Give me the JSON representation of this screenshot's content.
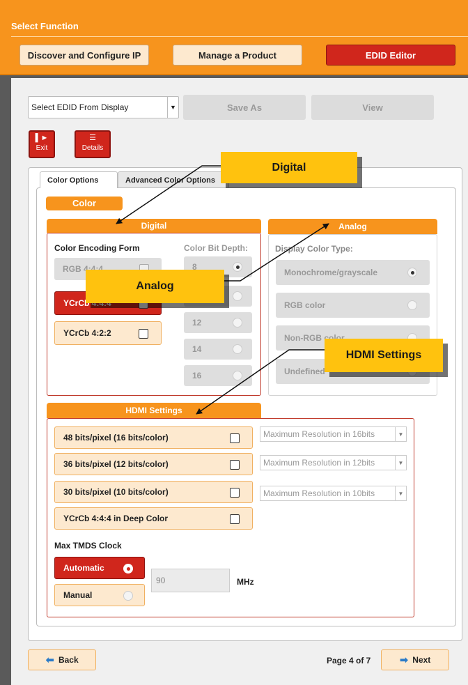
{
  "header": {
    "title": "Select Function",
    "buttons": {
      "discover": "Discover and Configure IP",
      "manage": "Manage a Product",
      "edid": "EDID Editor"
    }
  },
  "toolbar": {
    "edid_select": "Select EDID From Display",
    "save_as": "Save As",
    "view": "View",
    "exit": "Exit",
    "details": "Details"
  },
  "tabs": {
    "color_options": "Color Options",
    "advanced": "Advanced Color Options"
  },
  "color_section": {
    "title": "Color",
    "digital": {
      "header": "Digital",
      "encoding_label": "Color Encoding Form",
      "encodings": [
        "RGB 4:4:4",
        "YCrCb 4:4:4",
        "YCrCb 4:2:2"
      ],
      "bit_depth_label": "Color Bit Depth:",
      "bit_depths": [
        "8",
        "10",
        "12",
        "14",
        "16"
      ]
    },
    "analog": {
      "header": "Analog",
      "type_label": "Display Color Type:",
      "types": [
        "Monochrome/grayscale",
        "RGB color",
        "Non-RGB color",
        "Undefined"
      ]
    }
  },
  "hdmi": {
    "header": "HDMI Settings",
    "options": [
      "48 bits/pixel (16 bits/color)",
      "36 bits/pixel (12 bits/color)",
      "30 bits/pixel (10 bits/color)",
      "YCrCb 4:4:4 in Deep Color"
    ],
    "resolutions": [
      "Maximum Resolution in 16bits",
      "Maximum Resolution in 12bits",
      "Maximum Resolution in 10bits"
    ],
    "tmds_label": "Max TMDS Clock",
    "automatic": "Automatic",
    "manual": "Manual",
    "mhz_value": "90",
    "mhz_unit": "MHz"
  },
  "footer": {
    "back": "Back",
    "page": "Page 4 of 7",
    "next": "Next"
  },
  "callouts": {
    "digital": "Digital",
    "analog": "Analog",
    "hdmi": "HDMI Settings"
  },
  "colors": {
    "accent_orange": "#f7941d",
    "active_red": "#d0261c",
    "callout_yellow": "#ffc20e"
  }
}
